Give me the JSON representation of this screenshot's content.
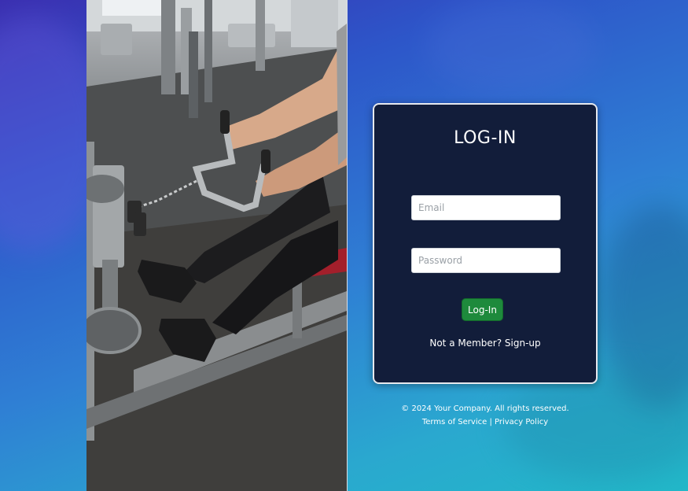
{
  "login": {
    "title": "LOG-IN",
    "email_placeholder": "Email",
    "password_placeholder": "Password",
    "submit_label": "Log-In",
    "signup_text": "Not a Member? Sign-up"
  },
  "footer": {
    "copyright": "© 2024 Your Company. All rights reserved.",
    "terms_label": "Terms of Service",
    "separator": "|",
    "privacy_label": "Privacy Policy"
  },
  "colors": {
    "card_background": "#121d3a",
    "button_green": "#1e8a3c",
    "background_gradient_start": "#3a2fb0",
    "background_gradient_end": "#22b8c8"
  }
}
